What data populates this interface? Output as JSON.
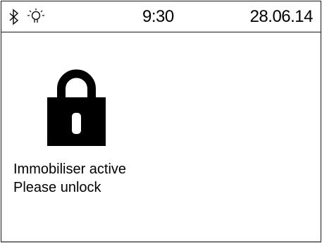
{
  "status_bar": {
    "bluetooth_icon": "bluetooth-icon",
    "light_icon": "light-sensor-icon",
    "time": "9:30",
    "date": "28.06.14"
  },
  "main": {
    "lock_icon": "padlock-icon",
    "message_line1": "Immobiliser active",
    "message_line2": "Please unlock"
  }
}
